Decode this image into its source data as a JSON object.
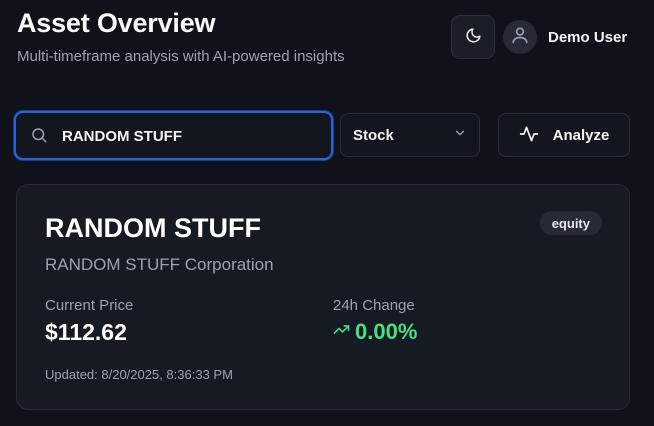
{
  "header": {
    "title": "Asset Overview",
    "subtitle": "Multi-timeframe analysis with AI-powered insights",
    "user_name": "Demo User",
    "theme_icon": "moon-icon",
    "avatar_icon": "user-icon"
  },
  "search": {
    "value": "RANDOM STUFF",
    "icon": "search-icon"
  },
  "asset_type": {
    "selected": "Stock",
    "icon": "chevron-down-icon"
  },
  "analyze": {
    "label": "Analyze",
    "icon": "activity-icon"
  },
  "asset": {
    "ticker": "RANDOM STUFF",
    "name": "RANDOM STUFF Corporation",
    "badge": "equity",
    "price_label": "Current Price",
    "price": "$112.62",
    "change_label": "24h Change",
    "change": "0.00%",
    "change_icon": "trending-up-icon",
    "updated": "Updated: 8/20/2025, 8:36:33 PM"
  },
  "colors": {
    "background": "#0f121a",
    "card": "#161a23",
    "accent_focus": "#2b62d8",
    "positive": "#4ade80",
    "muted_text": "#9ca3af"
  }
}
